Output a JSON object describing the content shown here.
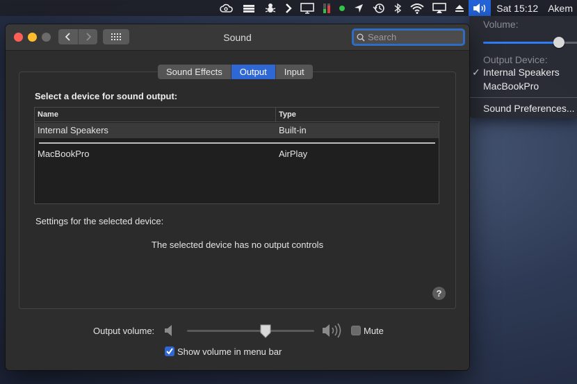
{
  "menubar": {
    "clock": "Sat 15:12",
    "user": "Akem",
    "icons": [
      "creative-cloud-icon",
      "crown-icon",
      "bug-icon",
      "chevron-right-icon",
      "display-icon",
      "meter-icon",
      "status-dot-icon",
      "location-icon",
      "time-machine-icon",
      "bluetooth-icon",
      "wifi-icon",
      "airplay-icon",
      "eject-icon",
      "volume-icon"
    ]
  },
  "dropdown": {
    "volume_label": "Volume:",
    "volume_level": 0.78,
    "output_device_label": "Output Device:",
    "check_mark": "✓",
    "devices": [
      {
        "label": "Internal Speakers",
        "checked": true
      },
      {
        "label": "MacBookPro",
        "checked": false
      }
    ],
    "preferences": "Sound Preferences..."
  },
  "window": {
    "title": "Sound",
    "search_placeholder": "Search",
    "tabs": [
      {
        "label": "Sound Effects",
        "selected": false
      },
      {
        "label": "Output",
        "selected": true
      },
      {
        "label": "Input",
        "selected": false
      }
    ],
    "section_heading": "Select a device for sound output:",
    "table": {
      "columns": [
        "Name",
        "Type"
      ],
      "rows": [
        {
          "name": "Internal Speakers",
          "type": "Built-in",
          "selected": true
        },
        {
          "name": "MacBookPro",
          "type": "AirPlay",
          "selected": false
        }
      ]
    },
    "settings_label": "Settings for the selected device:",
    "no_controls_message": "The selected device has no output controls",
    "help": "?",
    "output_volume_label": "Output volume:",
    "output_volume_level": 0.62,
    "mute_label": "Mute",
    "mute_checked": false,
    "show_volume_label": "Show volume in menu bar",
    "show_volume_checked": true
  },
  "colors": {
    "accent": "#2f68d4",
    "menu_highlight": "#2463d6",
    "close": "#ff5f57",
    "minimize": "#febc2e"
  }
}
